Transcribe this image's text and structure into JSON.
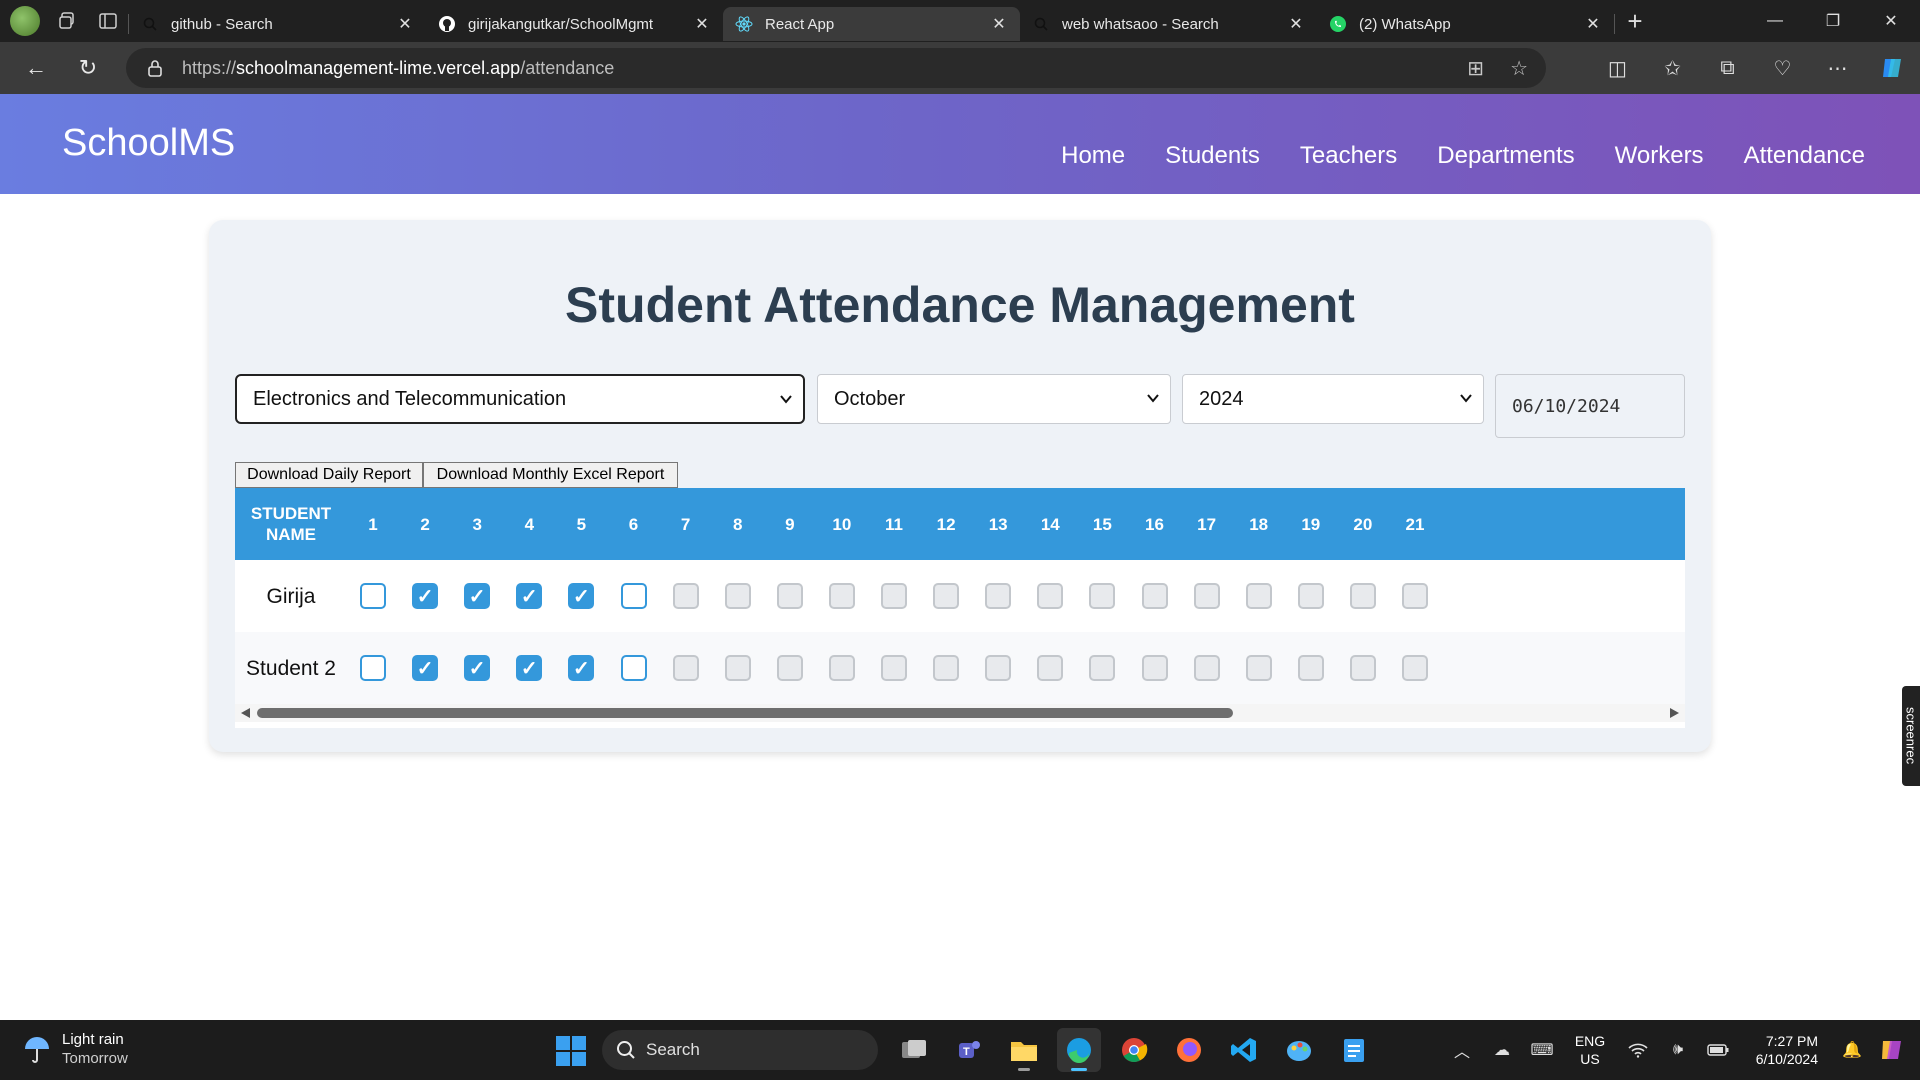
{
  "browser": {
    "tabs": [
      {
        "title": "github - Search",
        "active": false
      },
      {
        "title": "girijakangutkar/SchoolMgmt",
        "active": false
      },
      {
        "title": "React App",
        "active": true
      },
      {
        "title": "web whatsaoo - Search",
        "active": false
      },
      {
        "title": "(2) WhatsApp",
        "active": false
      }
    ],
    "url_prefix": "https://",
    "url_host": "schoolmanagement-lime.vercel.app",
    "url_path": "/attendance"
  },
  "site": {
    "logo": "SchoolMS",
    "nav": [
      "Home",
      "Students",
      "Teachers",
      "Departments",
      "Workers",
      "Attendance"
    ]
  },
  "main": {
    "title": "Student Attendance Management",
    "department": "Electronics and Telecommunication",
    "month": "October",
    "year": "2024",
    "date": "06/10/2024",
    "download_daily": "Download Daily Report",
    "download_monthly": "Download Monthly Excel Report"
  },
  "table": {
    "name_header": "STUDENT NAME",
    "days": [
      "1",
      "2",
      "3",
      "4",
      "5",
      "6",
      "7",
      "8",
      "9",
      "10",
      "11",
      "12",
      "13",
      "14",
      "15",
      "16",
      "17",
      "18",
      "19",
      "20",
      "21"
    ],
    "students": [
      {
        "name": "Girija",
        "states": [
          "empty",
          "on",
          "on",
          "on",
          "on",
          "empty",
          "dis",
          "dis",
          "dis",
          "dis",
          "dis",
          "dis",
          "dis",
          "dis",
          "dis",
          "dis",
          "dis",
          "dis",
          "dis",
          "dis",
          "dis"
        ]
      },
      {
        "name": "Student 2",
        "states": [
          "empty",
          "on",
          "on",
          "on",
          "on",
          "empty",
          "dis",
          "dis",
          "dis",
          "dis",
          "dis",
          "dis",
          "dis",
          "dis",
          "dis",
          "dis",
          "dis",
          "dis",
          "dis",
          "dis",
          "dis"
        ]
      }
    ]
  },
  "overlay": {
    "screenrec": "screenrec"
  },
  "taskbar": {
    "weather_title": "Light rain",
    "weather_sub": "Tomorrow",
    "search": "Search",
    "lang_top": "ENG",
    "lang_bottom": "US",
    "time": "7:27 PM",
    "date": "6/10/2024"
  },
  "colors": {
    "header_gradient": [
      "#6a7de0",
      "#7e52b8"
    ],
    "table_header": "#3498db",
    "title": "#2c3e50"
  }
}
